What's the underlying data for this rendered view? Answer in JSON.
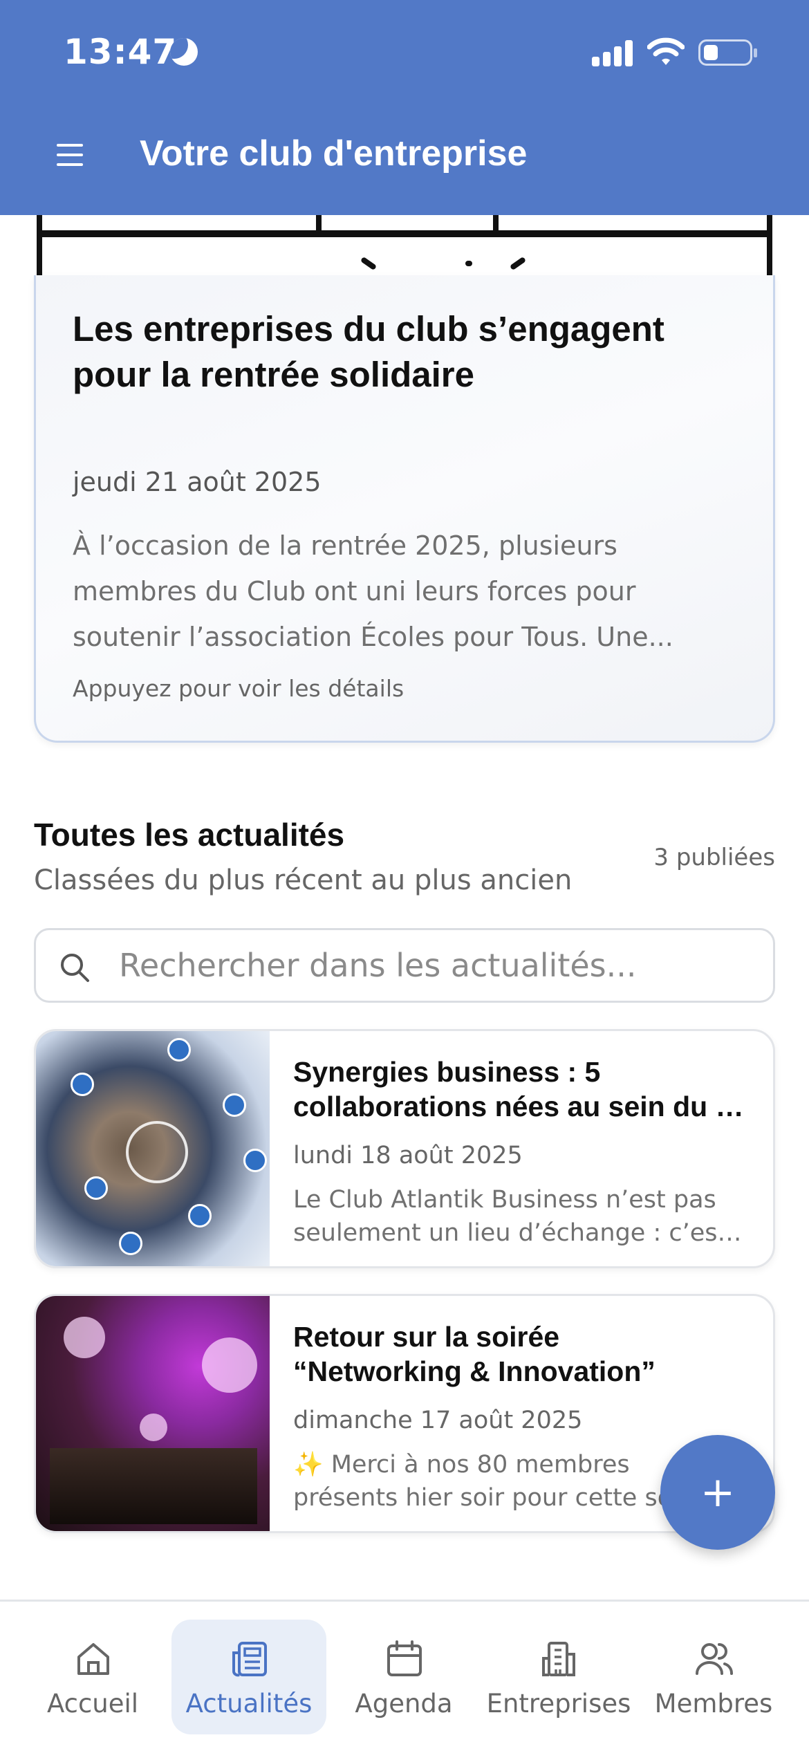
{
  "status_bar": {
    "time": "13:47"
  },
  "header": {
    "title": "Votre club d'entreprise"
  },
  "featured": {
    "title": "Les entreprises du club s’engagent pour la rentrée solidaire",
    "date": "jeudi 21 août 2025",
    "excerpt": "À l’occasion de la rentrée 2025, plusieurs membres du Club ont uni leurs forces pour soutenir l’association Écoles pour Tous. Une...",
    "hint": "Appuyez pour voir les détails"
  },
  "section": {
    "title": "Toutes les actualités",
    "subtitle": "Classées du plus récent au plus ancien",
    "count": "3 publiées"
  },
  "search": {
    "placeholder": "Rechercher dans les actualités..."
  },
  "news": [
    {
      "title_lines": [
        "Synergies business : 5",
        "collaborations nées au sein du club"
      ],
      "date": "lundi 18 août 2025",
      "excerpt_lines": [
        "Le Club Atlantik Business n’est pas",
        "seulement un lieu d’échange : c’est un lieu"
      ],
      "image": "hands-network-photo"
    },
    {
      "title_lines": [
        "Retour sur la soirée",
        "“Networking & Innovation”"
      ],
      "date": "dimanche 17 août 2025",
      "excerpt_lines": [
        "✨ Merci à nos 80 membres",
        "présents hier soir pour cette soirée"
      ],
      "image": "evening-party-photo"
    }
  ],
  "fab": {
    "label": "+"
  },
  "nav": [
    {
      "label": "Accueil",
      "icon": "home-icon",
      "active": false
    },
    {
      "label": "Actualités",
      "icon": "newspaper-icon",
      "active": true
    },
    {
      "label": "Agenda",
      "icon": "calendar-icon",
      "active": false
    },
    {
      "label": "Entreprises",
      "icon": "building-icon",
      "active": false
    },
    {
      "label": "Membres",
      "icon": "users-icon",
      "active": false
    }
  ],
  "colors": {
    "primary": "#5279C7",
    "active_nav_bg": "#E8EEF8"
  }
}
